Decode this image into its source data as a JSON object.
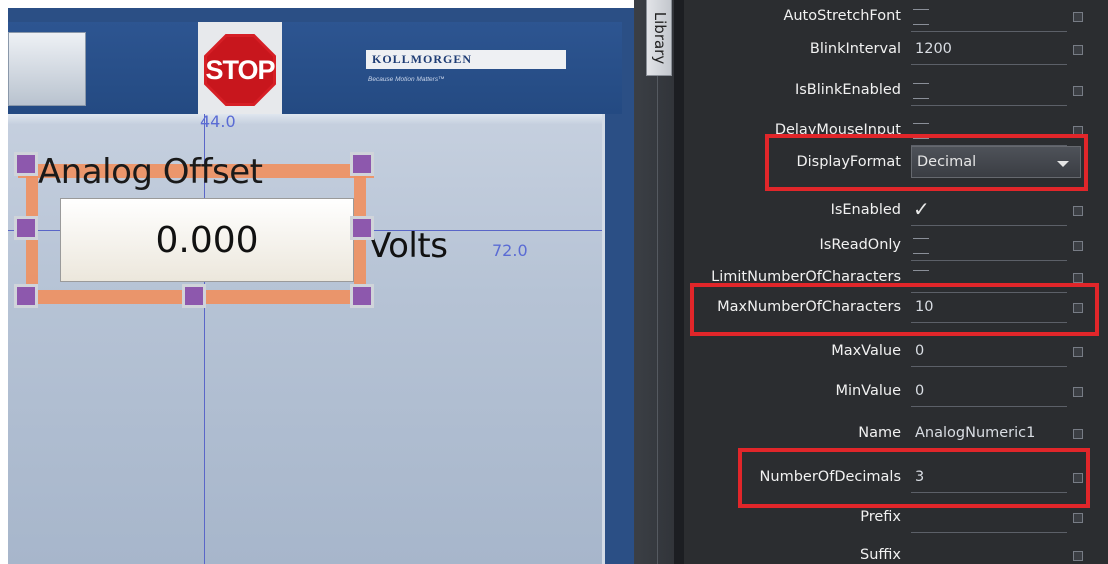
{
  "hmi": {
    "stop_text": "STOP",
    "brand_name": "KOLLMORGEN",
    "brand_tagline": "Because Motion Matters™",
    "widget": {
      "label": "Analog Offset",
      "value": "0.000",
      "units": "Volts"
    },
    "guides": {
      "top_readout": "44.0",
      "right_readout": "72.0"
    }
  },
  "side_tab": {
    "label": "Library"
  },
  "properties": [
    {
      "name": "AutoStretchFont",
      "type": "checkbox",
      "checked": false
    },
    {
      "name": "BlinkInterval",
      "type": "text",
      "value": "1200"
    },
    {
      "name": "IsBlinkEnabled",
      "type": "checkbox",
      "checked": false
    },
    {
      "name": "DelayMouseInput",
      "type": "checkbox",
      "checked": false
    },
    {
      "name": "DisplayFormat",
      "type": "dropdown",
      "value": "Decimal",
      "highlighted": true
    },
    {
      "name": "IsEnabled",
      "type": "checkbox",
      "checked": true
    },
    {
      "name": "IsReadOnly",
      "type": "checkbox",
      "checked": false
    },
    {
      "name": "LimitNumberOfCharacters",
      "type": "checkbox",
      "checked": false
    },
    {
      "name": "MaxNumberOfCharacters",
      "type": "text",
      "value": "10",
      "highlighted": true
    },
    {
      "name": "MaxValue",
      "type": "text",
      "value": "0"
    },
    {
      "name": "MinValue",
      "type": "text",
      "value": "0"
    },
    {
      "name": "Name",
      "type": "text",
      "value": "AnalogNumeric1"
    },
    {
      "name": "NumberOfDecimals",
      "type": "text",
      "value": "3",
      "highlighted": true
    },
    {
      "name": "Prefix",
      "type": "text",
      "value": ""
    },
    {
      "name": "Suffix",
      "type": "text",
      "value": ""
    }
  ],
  "colors": {
    "highlight": "#e1262a",
    "selection": "#f0905f",
    "handle": "#8d58ad",
    "guide": "#5a66c8",
    "panel_bg": "#2b2d30",
    "hmi_blue": "#2b4f85"
  }
}
